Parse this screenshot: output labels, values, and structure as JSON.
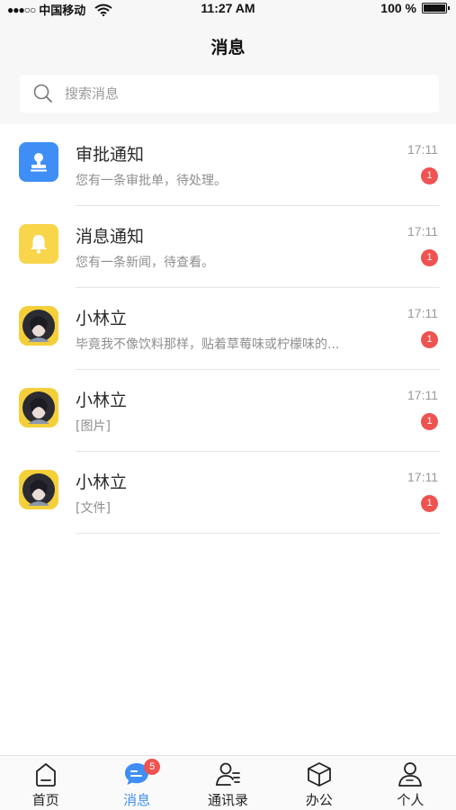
{
  "status_bar": {
    "signal": "●●●○○",
    "carrier": "中国移动",
    "time": "11:27 AM",
    "battery": "100 %"
  },
  "header": {
    "title": "消息"
  },
  "search": {
    "placeholder": "搜索消息"
  },
  "messages": [
    {
      "name": "审批通知",
      "preview": "您有一条审批单，待处理。",
      "time": "17:11",
      "badge": "1",
      "icon": "stamp-icon"
    },
    {
      "name": "消息通知",
      "preview": "您有一条新闻，待查看。",
      "time": "17:11",
      "badge": "1",
      "icon": "bell-icon"
    },
    {
      "name": "小林立",
      "preview": "毕竟我不像饮料那样，贴着草莓味或柠檬味的...",
      "time": "17:11",
      "badge": "1",
      "icon": "avatar"
    },
    {
      "name": "小林立",
      "preview": "[图片]",
      "time": "17:11",
      "badge": "1",
      "icon": "avatar"
    },
    {
      "name": "小林立",
      "preview": "[文件]",
      "time": "17:11",
      "badge": "1",
      "icon": "avatar"
    }
  ],
  "tabbar": {
    "tabs": [
      {
        "label": "首页",
        "icon": "home-icon"
      },
      {
        "label": "消息",
        "icon": "message-icon",
        "badge": "5",
        "active": true
      },
      {
        "label": "通讯录",
        "icon": "contacts-icon"
      },
      {
        "label": "办公",
        "icon": "cube-icon"
      },
      {
        "label": "个人",
        "icon": "person-icon"
      }
    ]
  },
  "colors": {
    "accent": "#3f8ef5",
    "badge": "#ef5350",
    "notice_yellow": "#f8d54a"
  }
}
